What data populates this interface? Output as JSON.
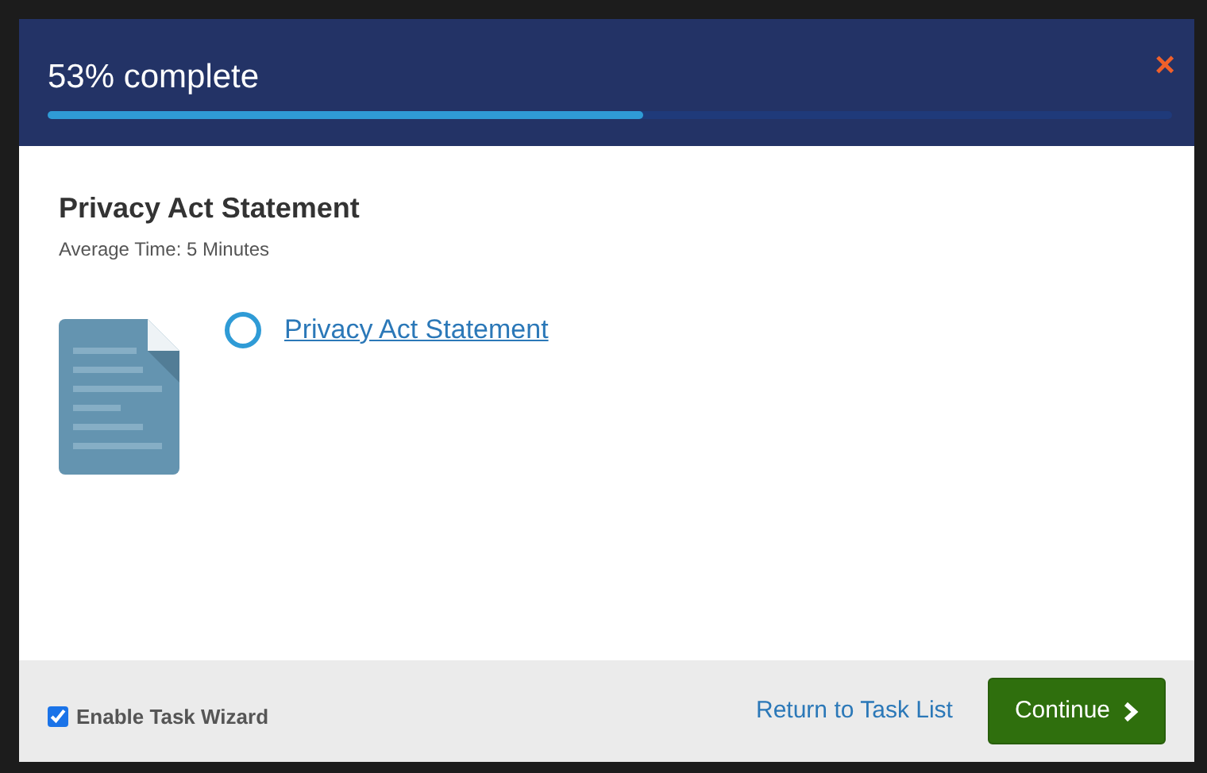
{
  "header": {
    "title": "53% complete",
    "progress": {
      "level": 0.53
    },
    "close": "×"
  },
  "section": {
    "title": "Privacy Act Statement",
    "subtitle": "Average Time: 5 Minutes"
  },
  "tasks": [
    {
      "label": "Privacy Act Statement",
      "done": false
    }
  ],
  "footer": {
    "wizard": {
      "label": "Enable Task Wizard",
      "checked": true
    },
    "return_link": "Return to Task List",
    "continue": "Continue"
  }
}
